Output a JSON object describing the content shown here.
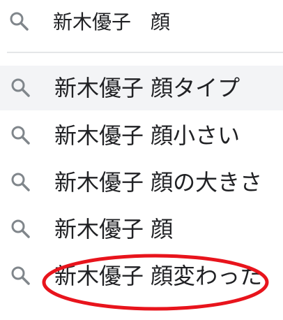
{
  "search": {
    "query": "新木優子　顔",
    "icon": "search-icon"
  },
  "suggestions": [
    {
      "label": "新木優子 顔タイプ",
      "icon": "search-icon",
      "highlighted": true
    },
    {
      "label": "新木優子 顔小さい",
      "icon": "search-icon",
      "highlighted": false
    },
    {
      "label": "新木優子 顔の大きさ",
      "icon": "search-icon",
      "highlighted": false
    },
    {
      "label": "新木優子 顔",
      "icon": "search-icon",
      "highlighted": false
    },
    {
      "label": "新木優子 顔変わった",
      "icon": "search-icon",
      "highlighted": false,
      "annotated": true
    }
  ],
  "colors": {
    "icon": "#80868b",
    "text": "#202124",
    "hover_row": "#f3f4f6",
    "annotation": "#e8141c"
  }
}
